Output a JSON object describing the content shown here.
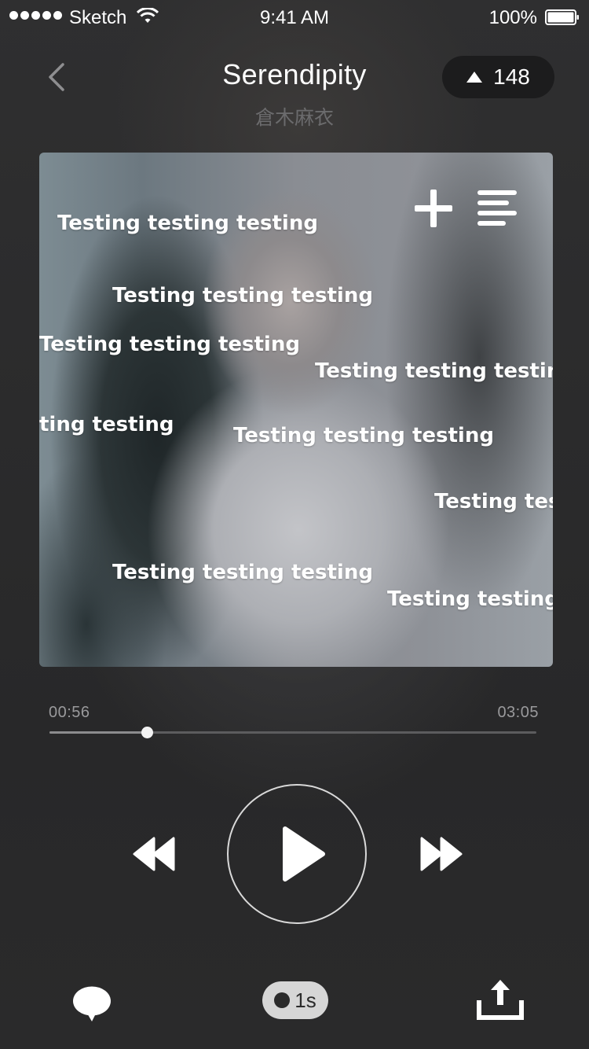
{
  "status_bar": {
    "carrier": "Sketch",
    "time": "9:41 AM",
    "battery": "100%"
  },
  "header": {
    "title": "Serendipity",
    "artist": "倉木麻衣",
    "counter": "148"
  },
  "danmaku": [
    {
      "text": "Testing testing testing"
    },
    {
      "text": "Testing testing testing"
    },
    {
      "text": "Testing testing testing"
    },
    {
      "text": "Testing testing testing"
    },
    {
      "text": "ting testing"
    },
    {
      "text": "Testing testing testing"
    },
    {
      "text": "Testing tes"
    },
    {
      "text": "Testing testing testing"
    },
    {
      "text": "Testing testing t"
    }
  ],
  "progress": {
    "current": "00:56",
    "total": "03:05",
    "fraction": 0.2
  },
  "speed": {
    "label": "1s"
  },
  "icons": {
    "back": "chevron-left-icon",
    "counter": "triangle-up-icon",
    "add": "plus-icon",
    "lyrics": "lyrics-lines-icon",
    "rewind": "rewind-icon",
    "play": "play-icon",
    "forward": "fast-forward-icon",
    "comment": "speech-bubble-icon",
    "share": "share-upload-icon"
  },
  "colors": {
    "background": "#2a2a2b",
    "accent": "#ffffff",
    "muted_text": "#6b6b6d",
    "pill": "#1c1c1d"
  }
}
